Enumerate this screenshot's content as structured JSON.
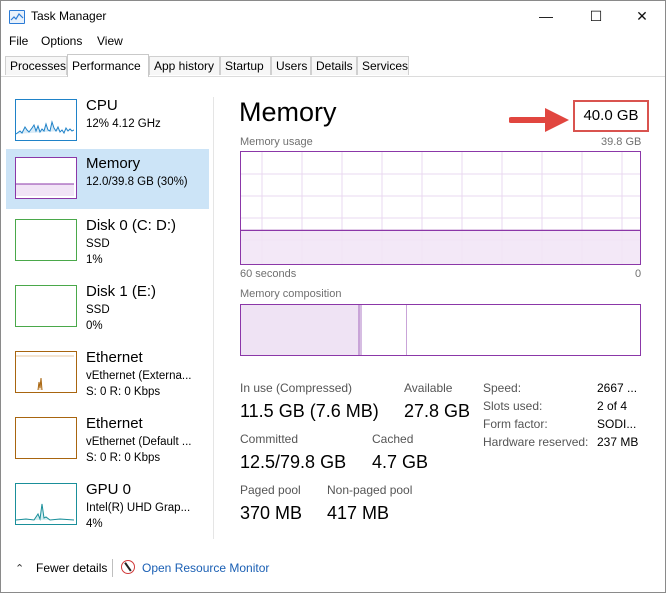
{
  "window": {
    "title": "Task Manager",
    "min": "—",
    "max": "☐",
    "close": "✕"
  },
  "menu": [
    "File",
    "Options",
    "View"
  ],
  "tabs": [
    "Processes",
    "Performance",
    "App history",
    "Startup",
    "Users",
    "Details",
    "Services"
  ],
  "sidebar": [
    {
      "title": "CPU",
      "lines": [
        "12% 4.12 GHz"
      ],
      "color": "#1f82c8"
    },
    {
      "title": "Memory",
      "lines": [
        "12.0/39.8 GB (30%)"
      ],
      "color": "#8b37a8"
    },
    {
      "title": "Disk 0 (C: D:)",
      "lines": [
        "SSD",
        "1%"
      ],
      "color": "#4aa84a"
    },
    {
      "title": "Disk 1 (E:)",
      "lines": [
        "SSD",
        "0%"
      ],
      "color": "#4aa84a"
    },
    {
      "title": "Ethernet",
      "lines": [
        "vEthernet (Externa...",
        "S: 0 R: 0 Kbps"
      ],
      "color": "#a8650f"
    },
    {
      "title": "Ethernet",
      "lines": [
        "vEthernet (Default ...",
        "S: 0 R: 0 Kbps"
      ],
      "color": "#a8650f"
    },
    {
      "title": "GPU 0",
      "lines": [
        "Intel(R) UHD Grap...",
        "4%"
      ],
      "color": "#1a8f9a"
    }
  ],
  "memory": {
    "title": "Memory",
    "total": "40.0 GB",
    "usage_label": "Memory usage",
    "usage_max": "39.8 GB",
    "usage_fraction": 0.3,
    "time_left": "60 seconds",
    "time_right": "0",
    "composition_label": "Memory composition",
    "stats": {
      "in_use_label": "In use (Compressed)",
      "in_use": "11.5 GB (7.6 MB)",
      "available_label": "Available",
      "available": "27.8 GB",
      "committed_label": "Committed",
      "committed": "12.5/79.8 GB",
      "cached_label": "Cached",
      "cached": "4.7 GB",
      "paged_label": "Paged pool",
      "paged": "370 MB",
      "nonpaged_label": "Non-paged pool",
      "nonpaged": "417 MB"
    },
    "kv": [
      {
        "label": "Speed:",
        "value": "2667 ..."
      },
      {
        "label": "Slots used:",
        "value": "2 of 4"
      },
      {
        "label": "Form factor:",
        "value": "SODI..."
      },
      {
        "label": "Hardware reserved:",
        "value": "237 MB"
      }
    ]
  },
  "footer": {
    "fewer": "Fewer details",
    "open_res": "Open Resource Monitor"
  },
  "colors": {
    "accent": "#8b37a8",
    "highlight": "#d9534f",
    "selected": "#cce4f7"
  }
}
